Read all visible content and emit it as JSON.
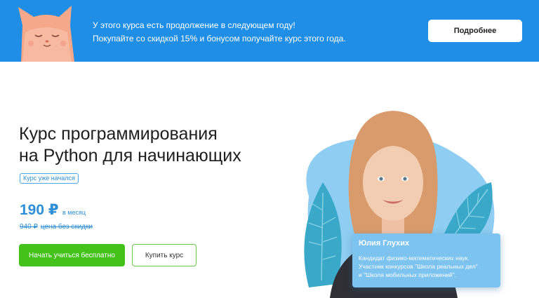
{
  "banner": {
    "line1": "У этого курса есть продолжение в следующем году!",
    "line2": "Покупайте со скидкой 15% и бонусом получайте курс этого года.",
    "button_label": "Подробнее",
    "bg_color": "#1e8ee6",
    "mascot_icon": "cat-mascot-icon"
  },
  "course": {
    "title_line1": "Курс программирования",
    "title_line2": "на Python для начинающих",
    "status": "Курс уже начался",
    "price": "190 ₽",
    "price_unit": "в месяц",
    "old_price": "940 ₽",
    "old_price_note": "цена без скидки",
    "start_free_label": "Начать учиться бесплатно",
    "buy_label": "Купить курс"
  },
  "teacher": {
    "name": "Юлия Глухих",
    "bio_line1": "Кандидат физико-математических наук.",
    "bio_line2": "Участник конкурсов \"Школа реальных дел\"",
    "bio_line3": "и \"Школа мобильных приложений\"."
  },
  "colors": {
    "accent_blue": "#2e8fd6",
    "cta_green": "#44c21a"
  }
}
